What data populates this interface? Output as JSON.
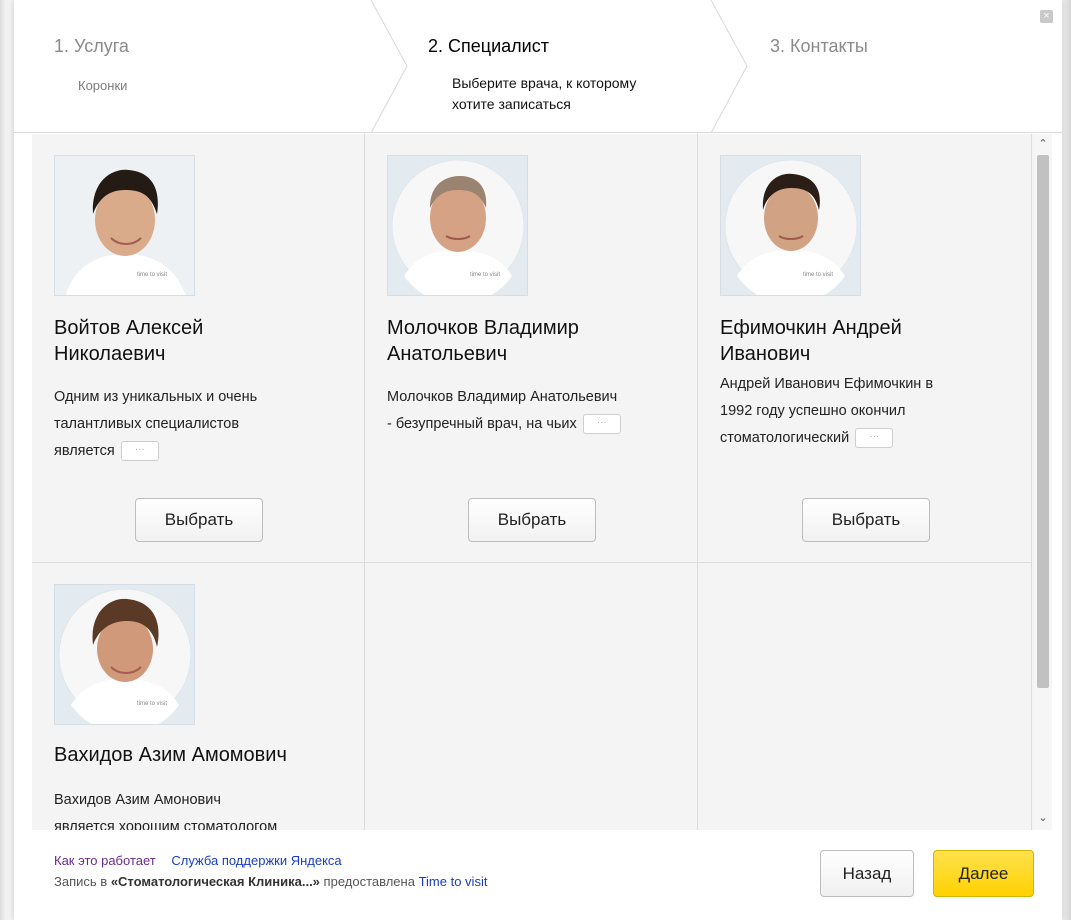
{
  "window": {
    "close_icon": "close-icon"
  },
  "steps": [
    {
      "title": "1. Услуга",
      "subtitle": "Коронки"
    },
    {
      "title": "2. Специалист",
      "subtitle_line1": "Выберите врача, к которому",
      "subtitle_line2": "хотите записаться"
    },
    {
      "title": "3. Контакты"
    }
  ],
  "doctors": [
    {
      "name_line1": "Войтов Алексей",
      "name_line2": "Николаевич",
      "desc_line1": "Одним из уникальных и очень",
      "desc_line2": "талантливых специалистов",
      "desc_line3": "является",
      "more": "···",
      "select": "Выбрать"
    },
    {
      "name_line1": "Молочков Владимир",
      "name_line2": "Анатольевич",
      "desc_line1": "Молочков Владимир Анатольевич",
      "desc_line2": "- безупречный врач, на чьих",
      "more": "···",
      "select": "Выбрать"
    },
    {
      "name_line1": "Ефимочкин Андрей",
      "name_line2": "Иванович",
      "desc_line1": "Андрей Иванович Ефимочкин в",
      "desc_line2": "1992 году успешно окончил",
      "desc_line3": "стоматологический",
      "more": "···",
      "select": "Выбрать"
    },
    {
      "name_line1": "Вахидов Азим Амомович",
      "desc_line1": "Вахидов Азим Амонович",
      "desc_line2": "является хорошим стоматологом"
    }
  ],
  "footer": {
    "how_it_works": "Как это работает",
    "support": "Служба поддержки Яндекса",
    "line2_prefix": "Запись в",
    "clinic": "«Стоматологическая Клиника...»",
    "line2_mid": "предоставлена",
    "provider": "Time to visit",
    "back": "Назад",
    "next": "Далее"
  },
  "colors": {
    "accent_yellow": "#ffd100",
    "link_blue": "#1a3dc1",
    "visited_purple": "#6a2a8c"
  }
}
